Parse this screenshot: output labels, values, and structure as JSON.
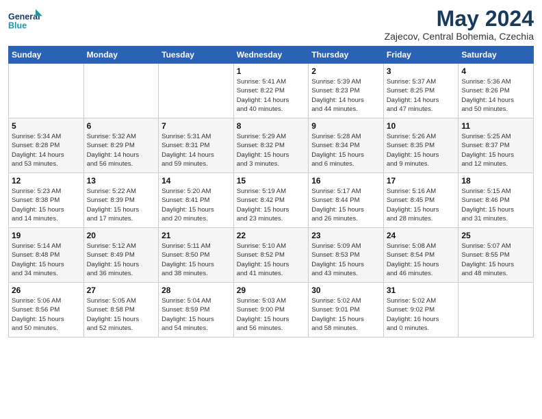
{
  "logo": {
    "line1": "General",
    "line2": "Blue"
  },
  "title": "May 2024",
  "subtitle": "Zajecov, Central Bohemia, Czechia",
  "days_header": [
    "Sunday",
    "Monday",
    "Tuesday",
    "Wednesday",
    "Thursday",
    "Friday",
    "Saturday"
  ],
  "weeks": [
    [
      {
        "day": "",
        "info": ""
      },
      {
        "day": "",
        "info": ""
      },
      {
        "day": "",
        "info": ""
      },
      {
        "day": "1",
        "info": "Sunrise: 5:41 AM\nSunset: 8:22 PM\nDaylight: 14 hours\nand 40 minutes."
      },
      {
        "day": "2",
        "info": "Sunrise: 5:39 AM\nSunset: 8:23 PM\nDaylight: 14 hours\nand 44 minutes."
      },
      {
        "day": "3",
        "info": "Sunrise: 5:37 AM\nSunset: 8:25 PM\nDaylight: 14 hours\nand 47 minutes."
      },
      {
        "day": "4",
        "info": "Sunrise: 5:36 AM\nSunset: 8:26 PM\nDaylight: 14 hours\nand 50 minutes."
      }
    ],
    [
      {
        "day": "5",
        "info": "Sunrise: 5:34 AM\nSunset: 8:28 PM\nDaylight: 14 hours\nand 53 minutes."
      },
      {
        "day": "6",
        "info": "Sunrise: 5:32 AM\nSunset: 8:29 PM\nDaylight: 14 hours\nand 56 minutes."
      },
      {
        "day": "7",
        "info": "Sunrise: 5:31 AM\nSunset: 8:31 PM\nDaylight: 14 hours\nand 59 minutes."
      },
      {
        "day": "8",
        "info": "Sunrise: 5:29 AM\nSunset: 8:32 PM\nDaylight: 15 hours\nand 3 minutes."
      },
      {
        "day": "9",
        "info": "Sunrise: 5:28 AM\nSunset: 8:34 PM\nDaylight: 15 hours\nand 6 minutes."
      },
      {
        "day": "10",
        "info": "Sunrise: 5:26 AM\nSunset: 8:35 PM\nDaylight: 15 hours\nand 9 minutes."
      },
      {
        "day": "11",
        "info": "Sunrise: 5:25 AM\nSunset: 8:37 PM\nDaylight: 15 hours\nand 12 minutes."
      }
    ],
    [
      {
        "day": "12",
        "info": "Sunrise: 5:23 AM\nSunset: 8:38 PM\nDaylight: 15 hours\nand 14 minutes."
      },
      {
        "day": "13",
        "info": "Sunrise: 5:22 AM\nSunset: 8:39 PM\nDaylight: 15 hours\nand 17 minutes."
      },
      {
        "day": "14",
        "info": "Sunrise: 5:20 AM\nSunset: 8:41 PM\nDaylight: 15 hours\nand 20 minutes."
      },
      {
        "day": "15",
        "info": "Sunrise: 5:19 AM\nSunset: 8:42 PM\nDaylight: 15 hours\nand 23 minutes."
      },
      {
        "day": "16",
        "info": "Sunrise: 5:17 AM\nSunset: 8:44 PM\nDaylight: 15 hours\nand 26 minutes."
      },
      {
        "day": "17",
        "info": "Sunrise: 5:16 AM\nSunset: 8:45 PM\nDaylight: 15 hours\nand 28 minutes."
      },
      {
        "day": "18",
        "info": "Sunrise: 5:15 AM\nSunset: 8:46 PM\nDaylight: 15 hours\nand 31 minutes."
      }
    ],
    [
      {
        "day": "19",
        "info": "Sunrise: 5:14 AM\nSunset: 8:48 PM\nDaylight: 15 hours\nand 34 minutes."
      },
      {
        "day": "20",
        "info": "Sunrise: 5:12 AM\nSunset: 8:49 PM\nDaylight: 15 hours\nand 36 minutes."
      },
      {
        "day": "21",
        "info": "Sunrise: 5:11 AM\nSunset: 8:50 PM\nDaylight: 15 hours\nand 38 minutes."
      },
      {
        "day": "22",
        "info": "Sunrise: 5:10 AM\nSunset: 8:52 PM\nDaylight: 15 hours\nand 41 minutes."
      },
      {
        "day": "23",
        "info": "Sunrise: 5:09 AM\nSunset: 8:53 PM\nDaylight: 15 hours\nand 43 minutes."
      },
      {
        "day": "24",
        "info": "Sunrise: 5:08 AM\nSunset: 8:54 PM\nDaylight: 15 hours\nand 46 minutes."
      },
      {
        "day": "25",
        "info": "Sunrise: 5:07 AM\nSunset: 8:55 PM\nDaylight: 15 hours\nand 48 minutes."
      }
    ],
    [
      {
        "day": "26",
        "info": "Sunrise: 5:06 AM\nSunset: 8:56 PM\nDaylight: 15 hours\nand 50 minutes."
      },
      {
        "day": "27",
        "info": "Sunrise: 5:05 AM\nSunset: 8:58 PM\nDaylight: 15 hours\nand 52 minutes."
      },
      {
        "day": "28",
        "info": "Sunrise: 5:04 AM\nSunset: 8:59 PM\nDaylight: 15 hours\nand 54 minutes."
      },
      {
        "day": "29",
        "info": "Sunrise: 5:03 AM\nSunset: 9:00 PM\nDaylight: 15 hours\nand 56 minutes."
      },
      {
        "day": "30",
        "info": "Sunrise: 5:02 AM\nSunset: 9:01 PM\nDaylight: 15 hours\nand 58 minutes."
      },
      {
        "day": "31",
        "info": "Sunrise: 5:02 AM\nSunset: 9:02 PM\nDaylight: 16 hours\nand 0 minutes."
      },
      {
        "day": "",
        "info": ""
      }
    ]
  ]
}
